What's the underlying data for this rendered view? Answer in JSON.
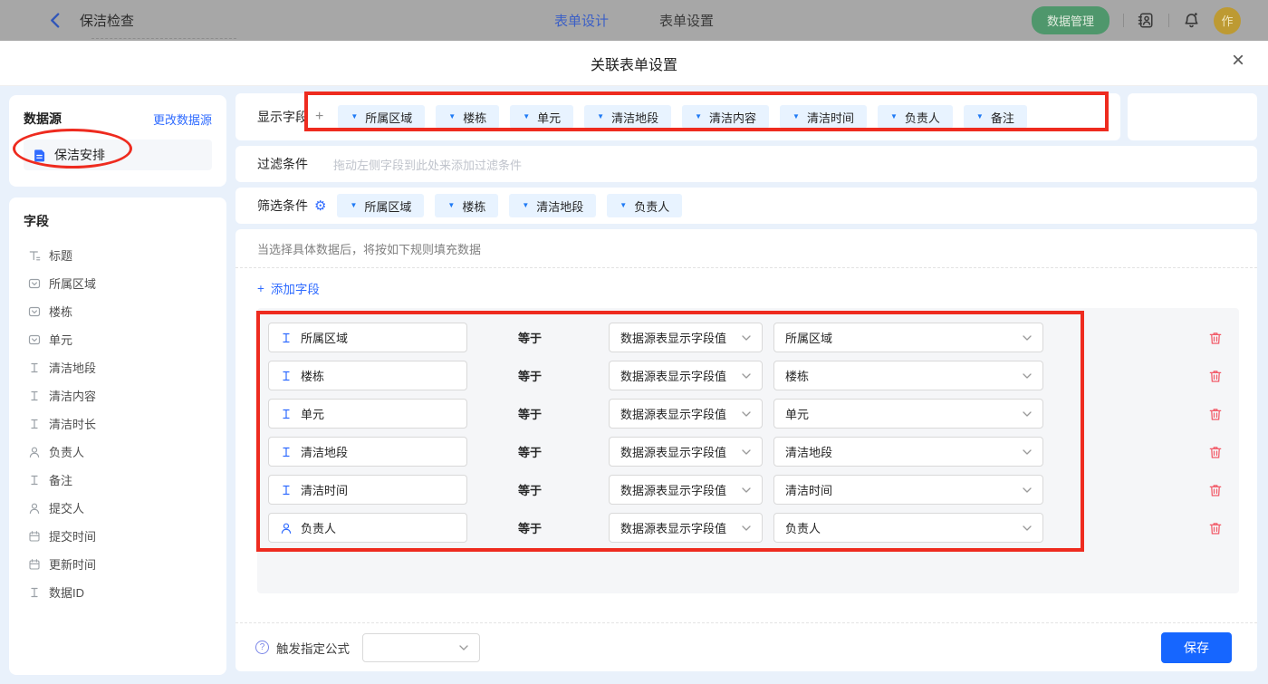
{
  "topbar": {
    "back_label": "保洁检查",
    "tabs": [
      {
        "label": "表单设计",
        "active": true
      },
      {
        "label": "表单设置",
        "active": false
      }
    ],
    "data_manage_label": "数据管理",
    "avatar_text": "作"
  },
  "modal": {
    "title": "关联表单设置",
    "close_icon": "×"
  },
  "sidebar": {
    "datasource_title": "数据源",
    "change_link": "更改数据源",
    "datasource_item": "保洁安排",
    "fields_title": "字段",
    "fields": [
      {
        "icon": "title-icon",
        "label": "标题"
      },
      {
        "icon": "select-icon",
        "label": "所属区域"
      },
      {
        "icon": "select-icon",
        "label": "楼栋"
      },
      {
        "icon": "select-icon",
        "label": "单元"
      },
      {
        "icon": "text-icon",
        "label": "清洁地段"
      },
      {
        "icon": "text-icon",
        "label": "清洁内容"
      },
      {
        "icon": "text-icon",
        "label": "清洁时长"
      },
      {
        "icon": "person-icon",
        "label": "负责人"
      },
      {
        "icon": "text-icon",
        "label": "备注"
      },
      {
        "icon": "person-icon",
        "label": "提交人"
      },
      {
        "icon": "calendar-icon",
        "label": "提交时间"
      },
      {
        "icon": "calendar-icon",
        "label": "更新时间"
      },
      {
        "icon": "text-icon",
        "label": "数据ID"
      }
    ]
  },
  "main": {
    "display_fields_label": "显示字段",
    "plus_icon": "+",
    "display_fields": [
      "所属区域",
      "楼栋",
      "单元",
      "清洁地段",
      "清洁内容",
      "清洁时间",
      "负责人",
      "备注"
    ],
    "filter_label": "过滤条件",
    "filter_placeholder": "拖动左侧字段到此处来添加过滤条件",
    "sift_label": "筛选条件",
    "gear_icon": "⚙",
    "sift_fields": [
      "所属区域",
      "楼栋",
      "清洁地段",
      "负责人"
    ],
    "hint": "当选择具体数据后，将按如下规则填充数据",
    "add_field_label": "添加字段",
    "rules": [
      {
        "icon": "text-icon",
        "field": "所属区域",
        "op": "等于",
        "source": "数据源表显示字段值",
        "value": "所属区域"
      },
      {
        "icon": "text-icon",
        "field": "楼栋",
        "op": "等于",
        "source": "数据源表显示字段值",
        "value": "楼栋"
      },
      {
        "icon": "text-icon",
        "field": "单元",
        "op": "等于",
        "source": "数据源表显示字段值",
        "value": "单元"
      },
      {
        "icon": "text-icon",
        "field": "清洁地段",
        "op": "等于",
        "source": "数据源表显示字段值",
        "value": "清洁地段"
      },
      {
        "icon": "text-icon",
        "field": "清洁时间",
        "op": "等于",
        "source": "数据源表显示字段值",
        "value": "清洁时间"
      },
      {
        "icon": "person-icon",
        "field": "负责人",
        "op": "等于",
        "source": "数据源表显示字段值",
        "value": "负责人"
      }
    ],
    "footer": {
      "formula_label": "触发指定公式",
      "save_label": "保存"
    }
  },
  "colors": {
    "accent_blue": "#2f6bff",
    "save_blue": "#1666ff",
    "tag_bg": "#e8f3ff",
    "tag_caret": "#1f7af5",
    "annotation_red": "#ee2b1f",
    "topbar_green": "#4f976c",
    "avatar_gold": "#bd9a33",
    "danger_red": "#f25a68",
    "page_bg": "#e9f1fb",
    "panel_gray": "#f5f6f8"
  }
}
